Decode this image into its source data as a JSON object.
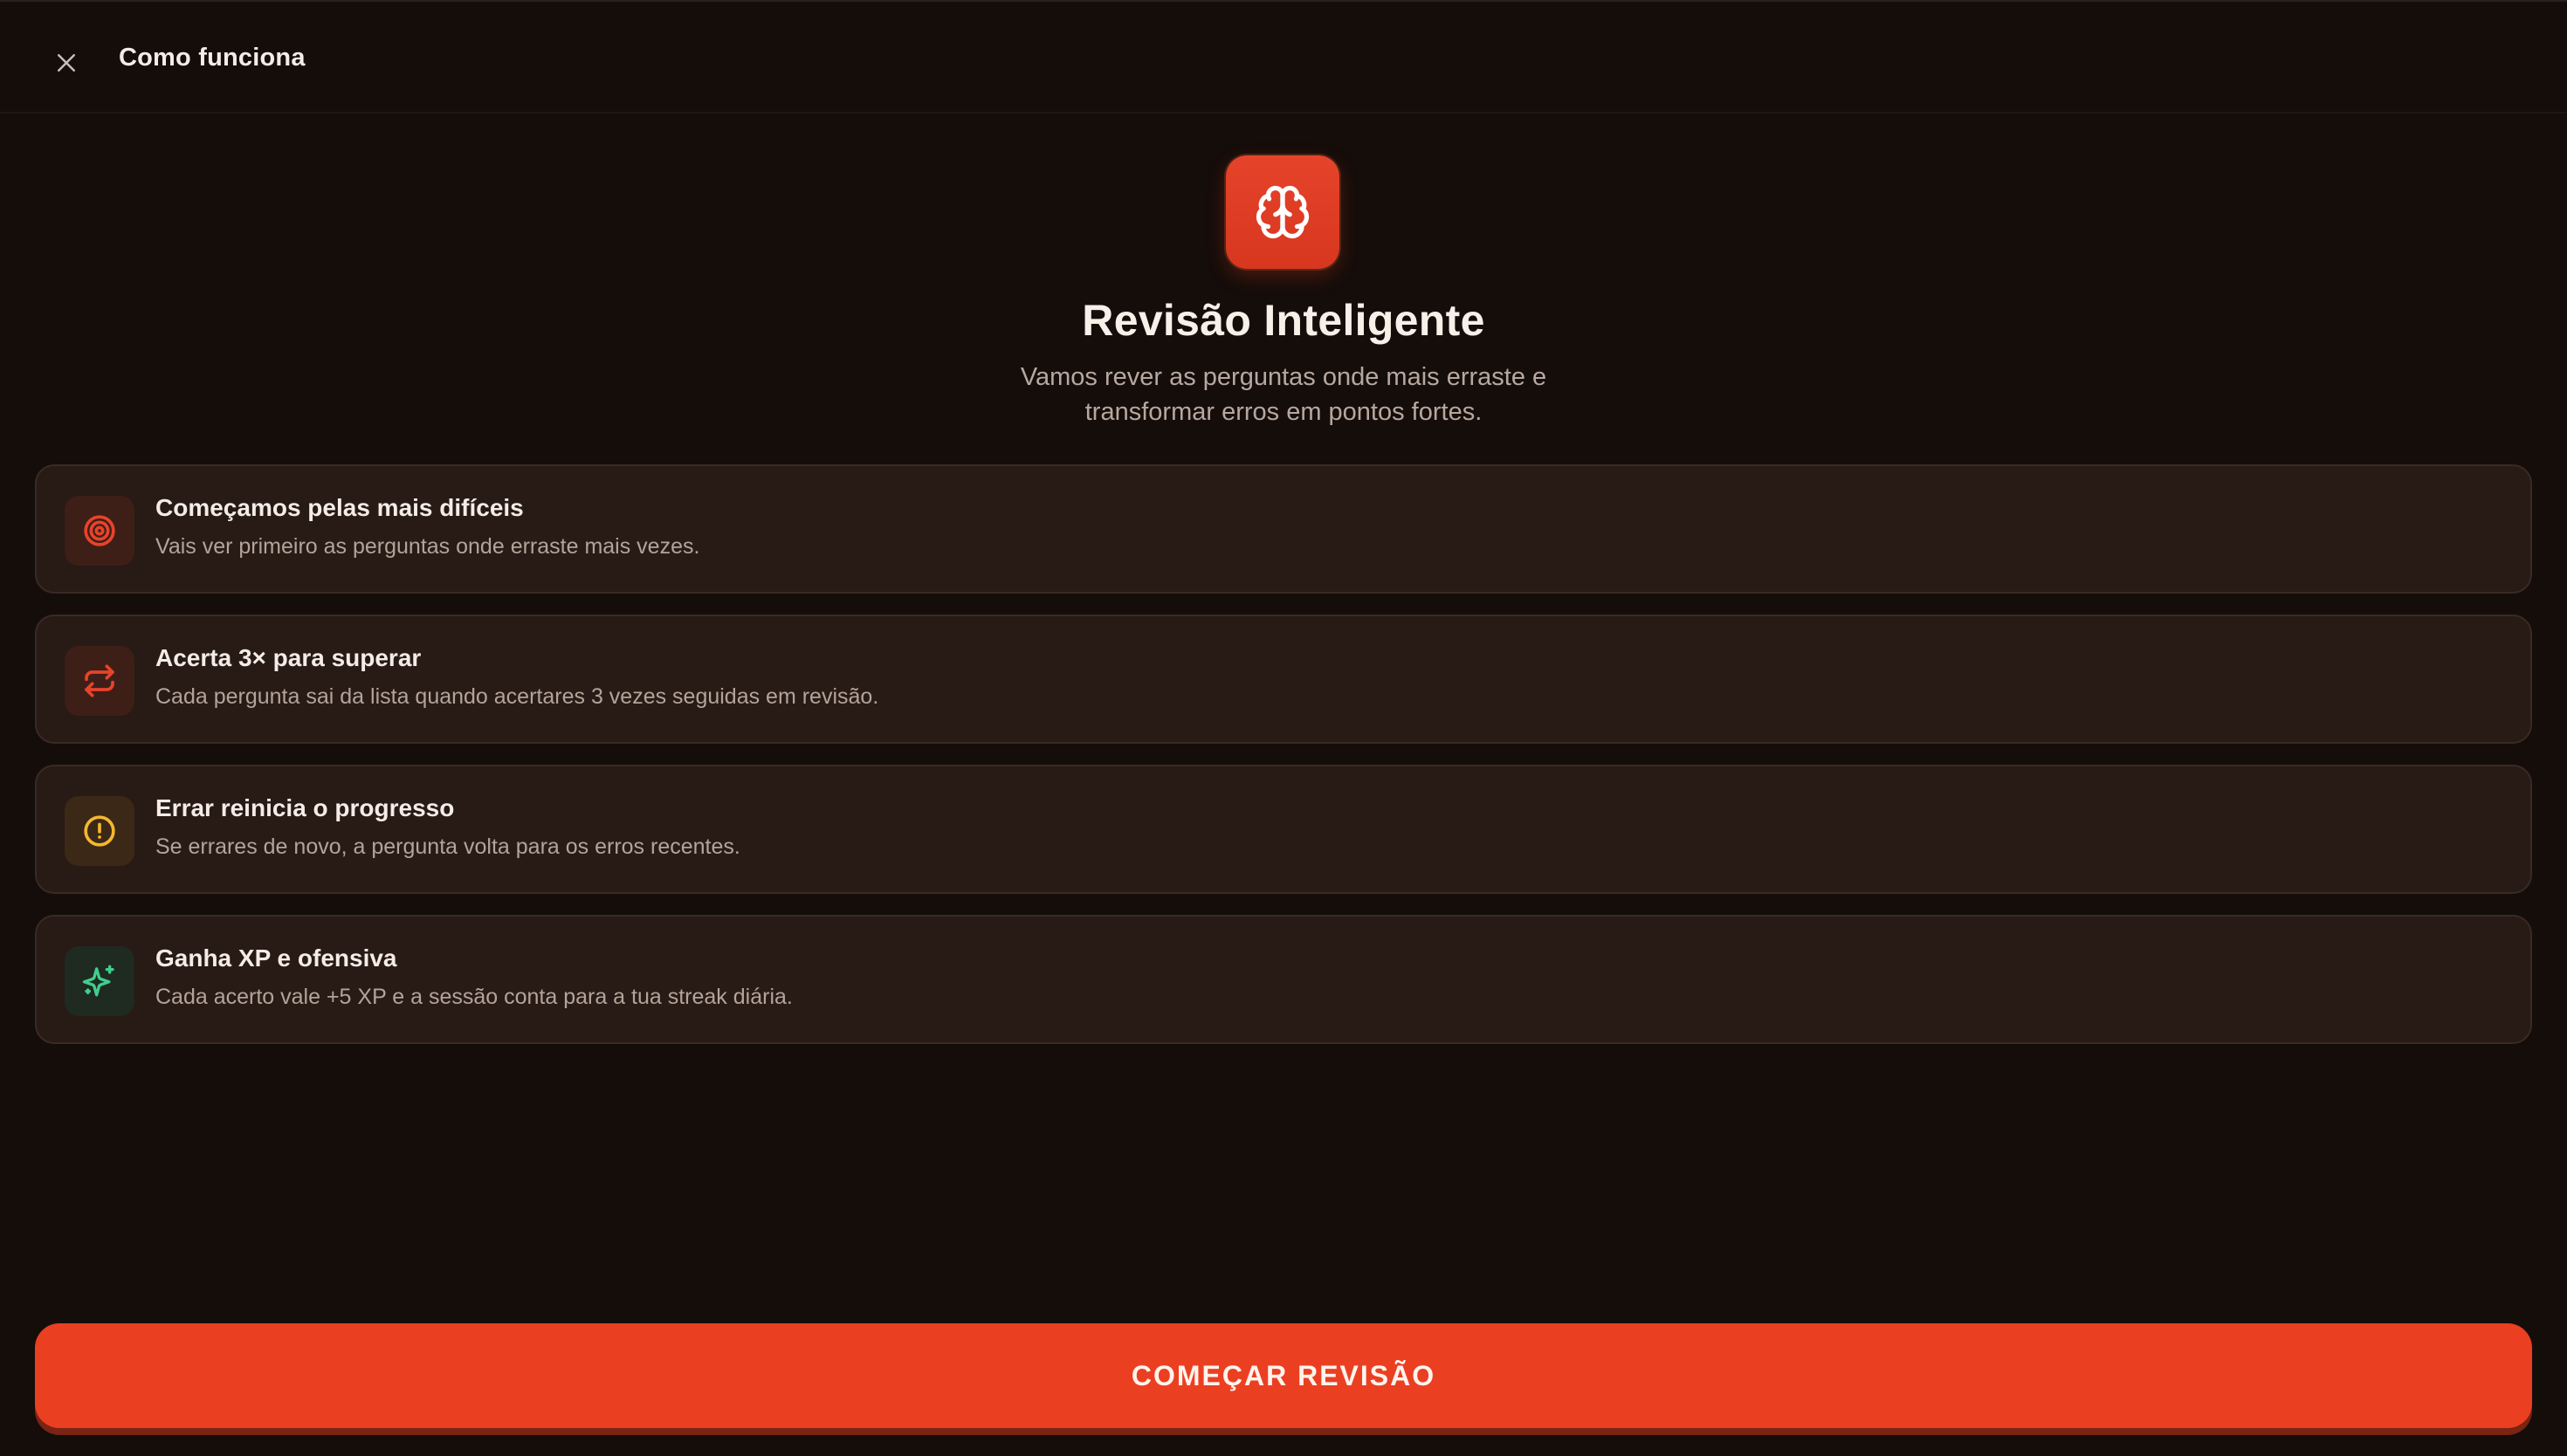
{
  "header": {
    "title": "Como funciona",
    "close_icon": "close-icon"
  },
  "hero": {
    "icon": "brain-icon",
    "title": "Revisão Inteligente",
    "subtitle": "Vamos rever as perguntas onde mais erraste e transformar erros em pontos fortes."
  },
  "steps": [
    {
      "icon": "target-icon",
      "icon_color": "#e8432a",
      "title": "Começamos pelas mais difíceis",
      "description": "Vais ver primeiro as perguntas onde erraste mais vezes."
    },
    {
      "icon": "repeat-icon",
      "icon_color": "#e8432a",
      "title": "Acerta 3× para superar",
      "description": "Cada pergunta sai da lista quando acertares 3 vezes seguidas em revisão."
    },
    {
      "icon": "alert-circle-icon",
      "icon_color": "#f5b82e",
      "title": "Errar reinicia o progresso",
      "description": "Se errares de novo, a pergunta volta para os erros recentes."
    },
    {
      "icon": "sparkles-icon",
      "icon_color": "#3fcf8e",
      "title": "Ganha XP e ofensiva",
      "description": "Cada acerto vale +5 XP e a sessão conta para a tua streak diária."
    }
  ],
  "cta": {
    "label": "COMEÇAR REVISÃO"
  },
  "colors": {
    "background": "#150d0a",
    "card": "#281a15",
    "accent": "#eb3f22"
  }
}
